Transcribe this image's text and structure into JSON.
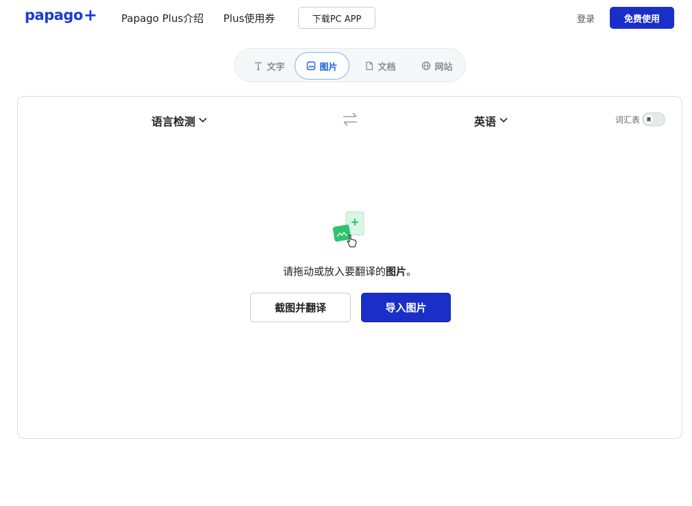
{
  "header": {
    "logo_text": "papago",
    "logo_plus": "+",
    "nav": {
      "intro": "Papago Plus介绍",
      "coupon": "Plus使用券"
    },
    "download_label": "下载PC APP",
    "login_label": "登录",
    "free_label": "免费使用"
  },
  "tabs": {
    "text": "文字",
    "image": "图片",
    "document": "文档",
    "website": "网站",
    "active": "image"
  },
  "translator": {
    "source_lang": "语言检测",
    "target_lang": "英语",
    "glossary_label": "词汇表",
    "glossary_enabled": false
  },
  "dropzone": {
    "message_prefix": "请拖动或放入要翻译的",
    "message_bold": "图片",
    "message_suffix": "。",
    "capture_label": "截图并翻译",
    "import_label": "导入图片"
  },
  "colors": {
    "brand": "#1a2fc7",
    "active_tab": "#1a5fd8",
    "illustration_green": "#2ec46c"
  }
}
